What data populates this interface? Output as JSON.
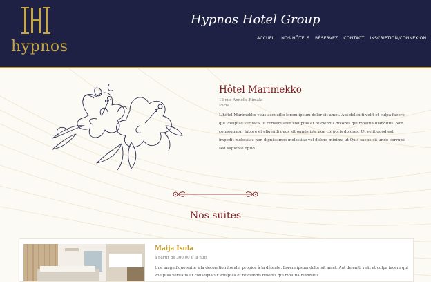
{
  "header": {
    "logo_text": "hypnos",
    "site_title": "Hypnos Hotel Group",
    "nav": [
      "ACCUEIL",
      "NOS HÔTELS",
      "RÉSERVEZ",
      "CONTACT",
      "INSCRIPTION/CONNEXION"
    ]
  },
  "hotel": {
    "name": "Hôtel Marimekko",
    "street": "12 rue Anneka Rimala",
    "city": "Paris",
    "description": "L'hôtel Marimekko vous accueille lorem ipsum dolor sit amet. Aut deleniti velit et culpa facere qui voluptas veritatis ut consequatur voluptas et reiciendis dolores qui mollitia blanditiis. Non consequatur labore et eligendi quos sit omnis iste non corporis dolores. Ut velit quod est impedit molestiae non dignissimos molestiae vel dolore minima ut Quis saepe sit unde corrupti sed sapiente optio."
  },
  "suites_title": "Nos suites",
  "suites": [
    {
      "name": "Maija Isola",
      "price": "à partir de 300.00 € la nuit",
      "description": "Une magnifique suite à la décoration florale, propice à la détente. Lorem ipsum dolor sit amet. Aut deleniti velit et culpa facere qui voluptas veritatis ut consequatur voluptas et reiciendis dolores qui mollitia blanditiis."
    }
  ],
  "colors": {
    "header_bg": "#1e2143",
    "gold": "#c7a743",
    "burgundy": "#7a1a1e",
    "page_bg": "#fcfaf5"
  }
}
